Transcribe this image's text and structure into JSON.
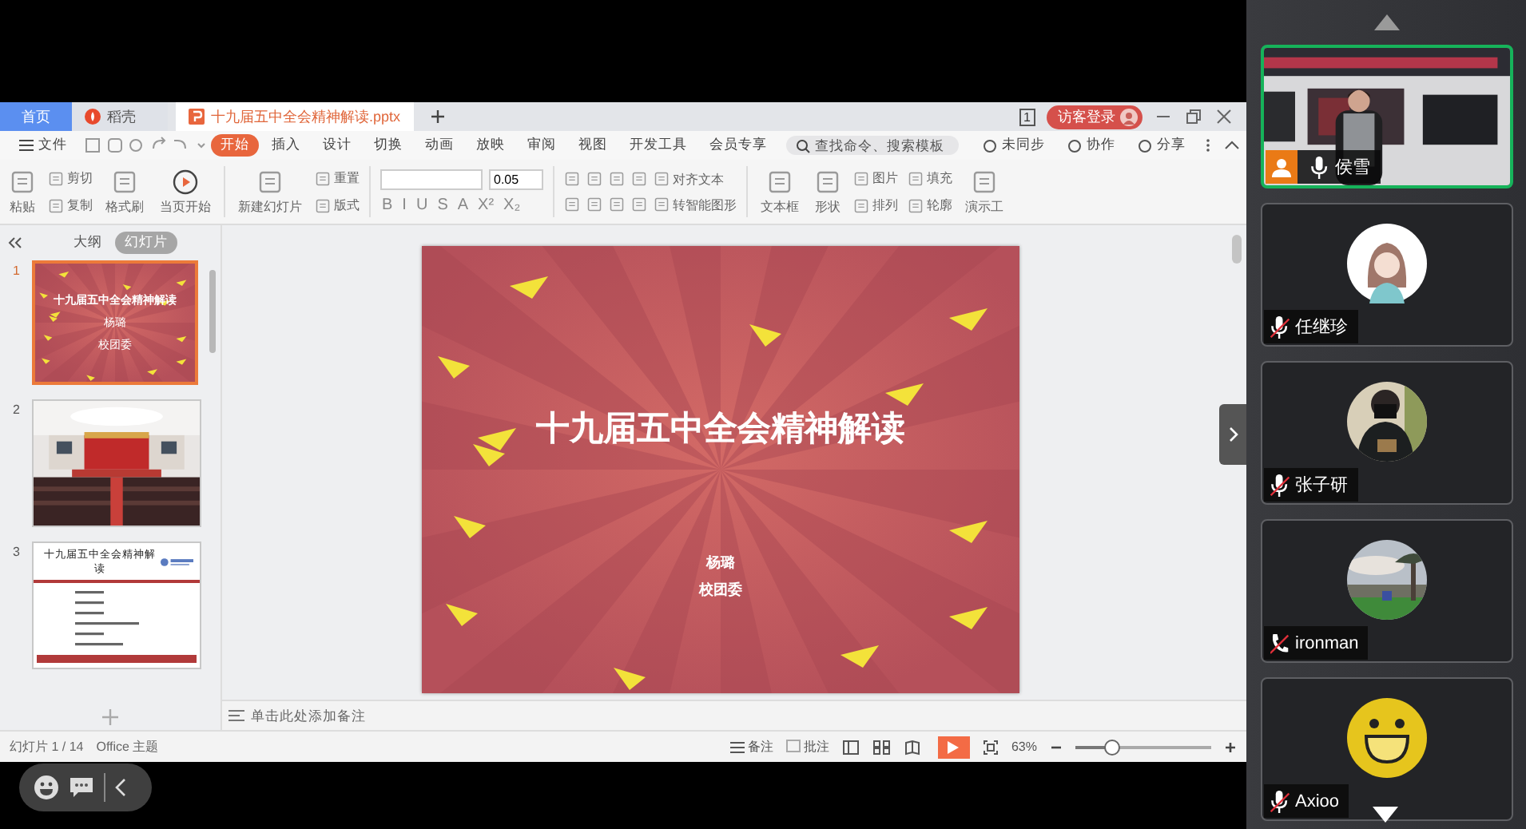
{
  "tabs": [
    {
      "label": "首页",
      "kind": "home",
      "selected": false
    },
    {
      "label": "稻壳",
      "kind": "store",
      "selected": false
    },
    {
      "label": "十九届五中全会精神解读.pptx",
      "kind": "document",
      "selected": true
    }
  ],
  "page_badge": "1",
  "login_button": "访客登录",
  "file_menu": "文件",
  "menu_tabs": [
    {
      "label": "开始",
      "selected": true
    },
    {
      "label": "插入",
      "selected": false
    },
    {
      "label": "设计",
      "selected": false
    },
    {
      "label": "切换",
      "selected": false
    },
    {
      "label": "动画",
      "selected": false
    },
    {
      "label": "放映",
      "selected": false
    },
    {
      "label": "审阅",
      "selected": false
    },
    {
      "label": "视图",
      "selected": false
    },
    {
      "label": "开发工具",
      "selected": false
    },
    {
      "label": "会员专享",
      "selected": false
    }
  ],
  "search": {
    "placeholder": "查找命令、搜索模板"
  },
  "menu_actions": [
    "未同步",
    "协作",
    "分享"
  ],
  "ribbon": [
    {
      "kind": "big",
      "label": "粘贴"
    },
    {
      "kind": "stack",
      "labels": [
        "剪切",
        "复制"
      ]
    },
    {
      "kind": "big",
      "label": "格式刷"
    },
    {
      "kind": "play",
      "label": "当页开始"
    },
    {
      "kind": "separator"
    },
    {
      "kind": "big",
      "label": "新建幻灯片"
    },
    {
      "kind": "stack",
      "labels": [
        "重置",
        "版式"
      ]
    },
    {
      "kind": "separator"
    },
    {
      "kind": "font",
      "size": "0.05",
      "format_buttons": [
        "B",
        "I",
        "U",
        "S",
        "A",
        "X²",
        "X₂"
      ]
    },
    {
      "kind": "separator"
    },
    {
      "kind": "paragraph",
      "labels": [
        "对齐文本",
        "转智能图形"
      ]
    },
    {
      "kind": "separator"
    },
    {
      "kind": "big",
      "label": "文本框"
    },
    {
      "kind": "big",
      "label": "形状"
    },
    {
      "kind": "stack",
      "labels": [
        "图片",
        "排列"
      ]
    },
    {
      "kind": "stack",
      "labels": [
        "填充",
        "轮廓"
      ]
    },
    {
      "kind": "big",
      "label": "演示工"
    }
  ],
  "pane_tabs": [
    {
      "label": "大纲",
      "selected": false
    },
    {
      "label": "幻灯片",
      "selected": true
    }
  ],
  "thumbnails": [
    {
      "number": "1",
      "kind": "title",
      "selected": true,
      "title": "十九届五中全会精神解读",
      "lines": [
        "杨璐",
        "校团委"
      ]
    },
    {
      "number": "2",
      "kind": "picture",
      "selected": false
    },
    {
      "number": "3",
      "kind": "list",
      "selected": false,
      "title": "十九届五中全会精神解读"
    }
  ],
  "slide": {
    "title": "十九届五中全会精神解读",
    "lines": [
      "杨璐",
      "校团委"
    ]
  },
  "notes": {
    "placeholder": "单击此处添加备注"
  },
  "status_bar": {
    "slide_count": "幻灯片 1 / 14",
    "theme": "Office 主题",
    "notes": "备注",
    "comments": "批注",
    "zoom": "63%",
    "zoom_slider": {
      "level": 0.27
    }
  },
  "participants": [
    {
      "name": "侯雪",
      "kind": "video",
      "phone": false,
      "muted": false,
      "host": true,
      "selected": true
    },
    {
      "name": "任继珍",
      "kind": "cartoon",
      "phone": false,
      "muted": true,
      "host": false,
      "selected": false
    },
    {
      "name": "张子研",
      "phone": false,
      "muted": true,
      "host": false,
      "selected": false
    },
    {
      "name": "ironman",
      "kind": "landscape",
      "phone": true,
      "muted": true,
      "host": false,
      "selected": false
    },
    {
      "name": "Axioo",
      "kind": "smiley",
      "phone": false,
      "muted": true,
      "host": false,
      "selected": false
    }
  ]
}
